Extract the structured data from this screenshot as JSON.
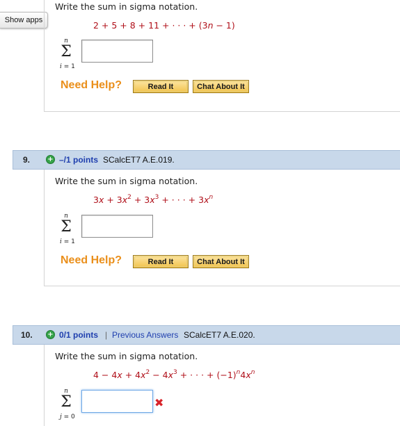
{
  "toolbar": {
    "show_apps": "Show apps"
  },
  "common": {
    "prompt": "Write the sum in sigma notation.",
    "sigma_upper": "n",
    "sigma_symbol": "Σ",
    "need_help": "Need Help?",
    "read_it": "Read It",
    "chat_about_it": "Chat About It"
  },
  "question_8": {
    "formula": "2 + 5 + 8 + 11 + · · · + (3n − 1)",
    "lower_index": "i = 1",
    "answer_value": ""
  },
  "question_9": {
    "number": "9.",
    "points": "–/1 points",
    "code": "SCalcET7 A.E.019.",
    "lower_index": "i = 1",
    "answer_value": ""
  },
  "question_10": {
    "number": "10.",
    "points": "0/1 points",
    "separator": "|",
    "previous_answers": "Previous Answers",
    "code": "SCalcET7 A.E.020.",
    "lower_index": "j = 0",
    "answer_value": "",
    "answer_status": "incorrect"
  },
  "colors": {
    "formula_red": "#b0101a",
    "need_help_orange": "#ea8f1b",
    "header_bar_blue": "#c8d8ea",
    "link_blue": "#1f3fae",
    "incorrect_red": "#d8232a"
  }
}
